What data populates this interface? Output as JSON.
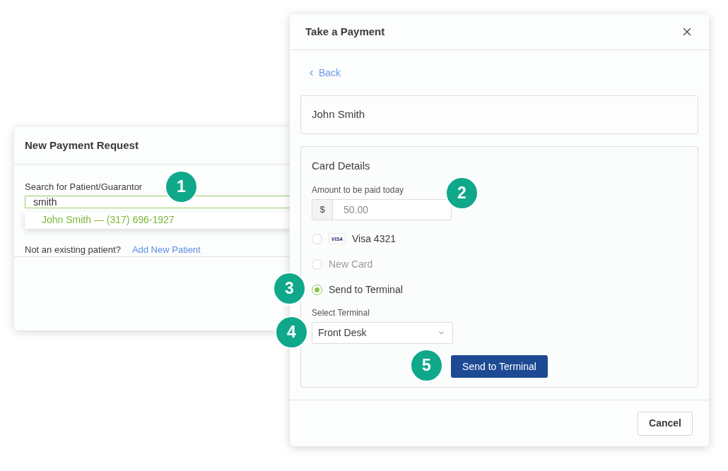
{
  "new_payment_request": {
    "title": "New Payment Request",
    "search": {
      "label": "Search for Patient/Guarantor",
      "value": "smith"
    },
    "results": [
      {
        "text": "John Smith — (317) 696-1927"
      }
    ],
    "prompt": "Not an existing patient?",
    "link": "Add New Patient"
  },
  "take_a_payment": {
    "title": "Take a Payment",
    "back": "Back",
    "patient": "John Smith",
    "card_details": {
      "title": "Card Details",
      "amount": {
        "label": "Amount to be paid today",
        "prefix": "$",
        "placeholder": "50.00"
      },
      "options": [
        {
          "kind": "card",
          "brand": "VISA",
          "label": "Visa 4321",
          "selected": false,
          "disabled": false
        },
        {
          "kind": "plain",
          "label": "New Card",
          "selected": false,
          "disabled": true
        },
        {
          "kind": "plain",
          "label": "Send to Terminal",
          "selected": true,
          "disabled": false
        }
      ],
      "terminal": {
        "label": "Select Terminal",
        "value": "Front Desk"
      },
      "button": "Send to Terminal"
    },
    "footer_buttons": [
      "Cancel"
    ]
  },
  "callouts": [
    "1",
    "2",
    "3",
    "4",
    "5"
  ]
}
